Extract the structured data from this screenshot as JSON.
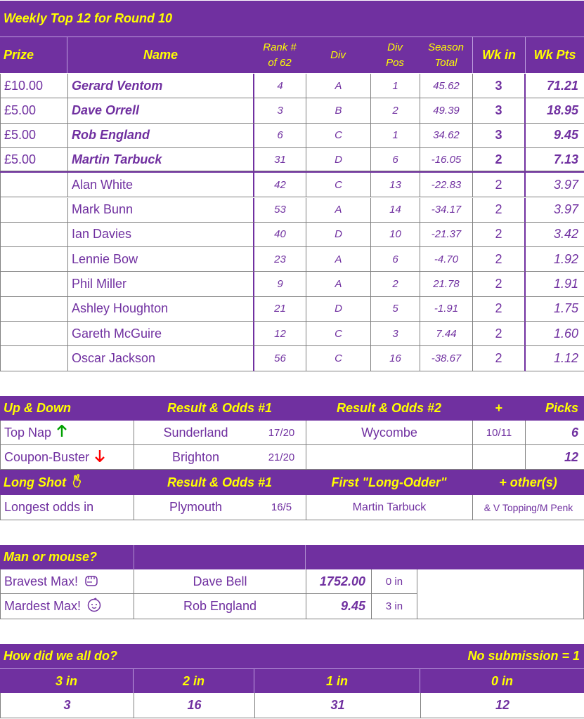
{
  "title": "Weekly Top 12 for Round 10",
  "top12": {
    "headers": {
      "prize": "Prize",
      "name": "Name",
      "rank": "Rank # of 62",
      "div": "Div",
      "divpos": "Div Pos",
      "season": "Season Total",
      "wkin": "Wk in",
      "wkpts": "Wk Pts"
    },
    "rows": [
      {
        "prize": "£10.00",
        "name": "Gerard Ventom",
        "rank": "4",
        "div": "A",
        "divpos": "1",
        "season": "45.62",
        "wkin": "3",
        "wkpts": "71.21"
      },
      {
        "prize": "£5.00",
        "name": "Dave Orrell",
        "rank": "3",
        "div": "B",
        "divpos": "2",
        "season": "49.39",
        "wkin": "3",
        "wkpts": "18.95"
      },
      {
        "prize": "£5.00",
        "name": "Rob England",
        "rank": "6",
        "div": "C",
        "divpos": "1",
        "season": "34.62",
        "wkin": "3",
        "wkpts": "9.45"
      },
      {
        "prize": "£5.00",
        "name": "Martin Tarbuck",
        "rank": "31",
        "div": "D",
        "divpos": "6",
        "season": "-16.05",
        "wkin": "2",
        "wkpts": "7.13"
      },
      {
        "prize": "",
        "name": "Alan White",
        "rank": "42",
        "div": "C",
        "divpos": "13",
        "season": "-22.83",
        "wkin": "2",
        "wkpts": "3.97"
      },
      {
        "prize": "",
        "name": "Mark Bunn",
        "rank": "53",
        "div": "A",
        "divpos": "14",
        "season": "-34.17",
        "wkin": "2",
        "wkpts": "3.97"
      },
      {
        "prize": "",
        "name": "Ian Davies",
        "rank": "40",
        "div": "D",
        "divpos": "10",
        "season": "-21.37",
        "wkin": "2",
        "wkpts": "3.42"
      },
      {
        "prize": "",
        "name": "Lennie Bow",
        "rank": "23",
        "div": "A",
        "divpos": "6",
        "season": "-4.70",
        "wkin": "2",
        "wkpts": "1.92"
      },
      {
        "prize": "",
        "name": "Phil Miller",
        "rank": "9",
        "div": "A",
        "divpos": "2",
        "season": "21.78",
        "wkin": "2",
        "wkpts": "1.91"
      },
      {
        "prize": "",
        "name": "Ashley Houghton",
        "rank": "21",
        "div": "D",
        "divpos": "5",
        "season": "-1.91",
        "wkin": "2",
        "wkpts": "1.75"
      },
      {
        "prize": "",
        "name": "Gareth McGuire",
        "rank": "12",
        "div": "C",
        "divpos": "3",
        "season": "7.44",
        "wkin": "2",
        "wkpts": "1.60"
      },
      {
        "prize": "",
        "name": "Oscar Jackson",
        "rank": "56",
        "div": "C",
        "divpos": "16",
        "season": "-38.67",
        "wkin": "2",
        "wkpts": "1.12"
      }
    ]
  },
  "updown": {
    "header": {
      "label": "Up & Down",
      "res1": "Result & Odds #1",
      "res2": "Result & Odds #2",
      "plus": "+",
      "picks": "Picks"
    },
    "topnap": {
      "label": "Top Nap",
      "team1": "Sunderland",
      "odds1": "17/20",
      "team2": "Wycombe",
      "odds2": "10/11",
      "picks": "6"
    },
    "coupon": {
      "label": "Coupon-Buster",
      "team1": "Brighton",
      "odds1": "21/20",
      "team2": "",
      "odds2": "",
      "picks": "12"
    },
    "longshot_header": {
      "label": "Long Shot",
      "res1": "Result & Odds #1",
      "first": "First \"Long-Odder\"",
      "others": "+ other(s)"
    },
    "longest": {
      "label": "Longest odds in",
      "team": "Plymouth",
      "odds": "16/5",
      "first": "Martin Tarbuck",
      "others": "& V Topping/M Penk"
    },
    "colors": {
      "up": "#00a000",
      "down": "#ff0000"
    },
    "icons": {
      "up": "up-arrow-icon",
      "down": "down-arrow-icon",
      "longshot": "crossed-fingers-icon"
    }
  },
  "manmouse": {
    "header": "Man or mouse?",
    "bravest": {
      "label": "Bravest Max!",
      "name": "Dave Bell",
      "pts": "1752.00",
      "in": "0 in",
      "icon": "fist-icon"
    },
    "mardest": {
      "label": "Mardest Max!",
      "name": "Rob England",
      "pts": "9.45",
      "in": "3 in",
      "icon": "baby-face-icon"
    }
  },
  "summary": {
    "header": "How did we all do?",
    "nosub": "No submission = 1",
    "cols": [
      {
        "label": "3 in",
        "value": "3"
      },
      {
        "label": "2 in",
        "value": "16"
      },
      {
        "label": "1 in",
        "value": "31"
      },
      {
        "label": "0 in",
        "value": "12"
      }
    ]
  },
  "brand_color": "#7030a0",
  "accent_color": "#ffff00"
}
